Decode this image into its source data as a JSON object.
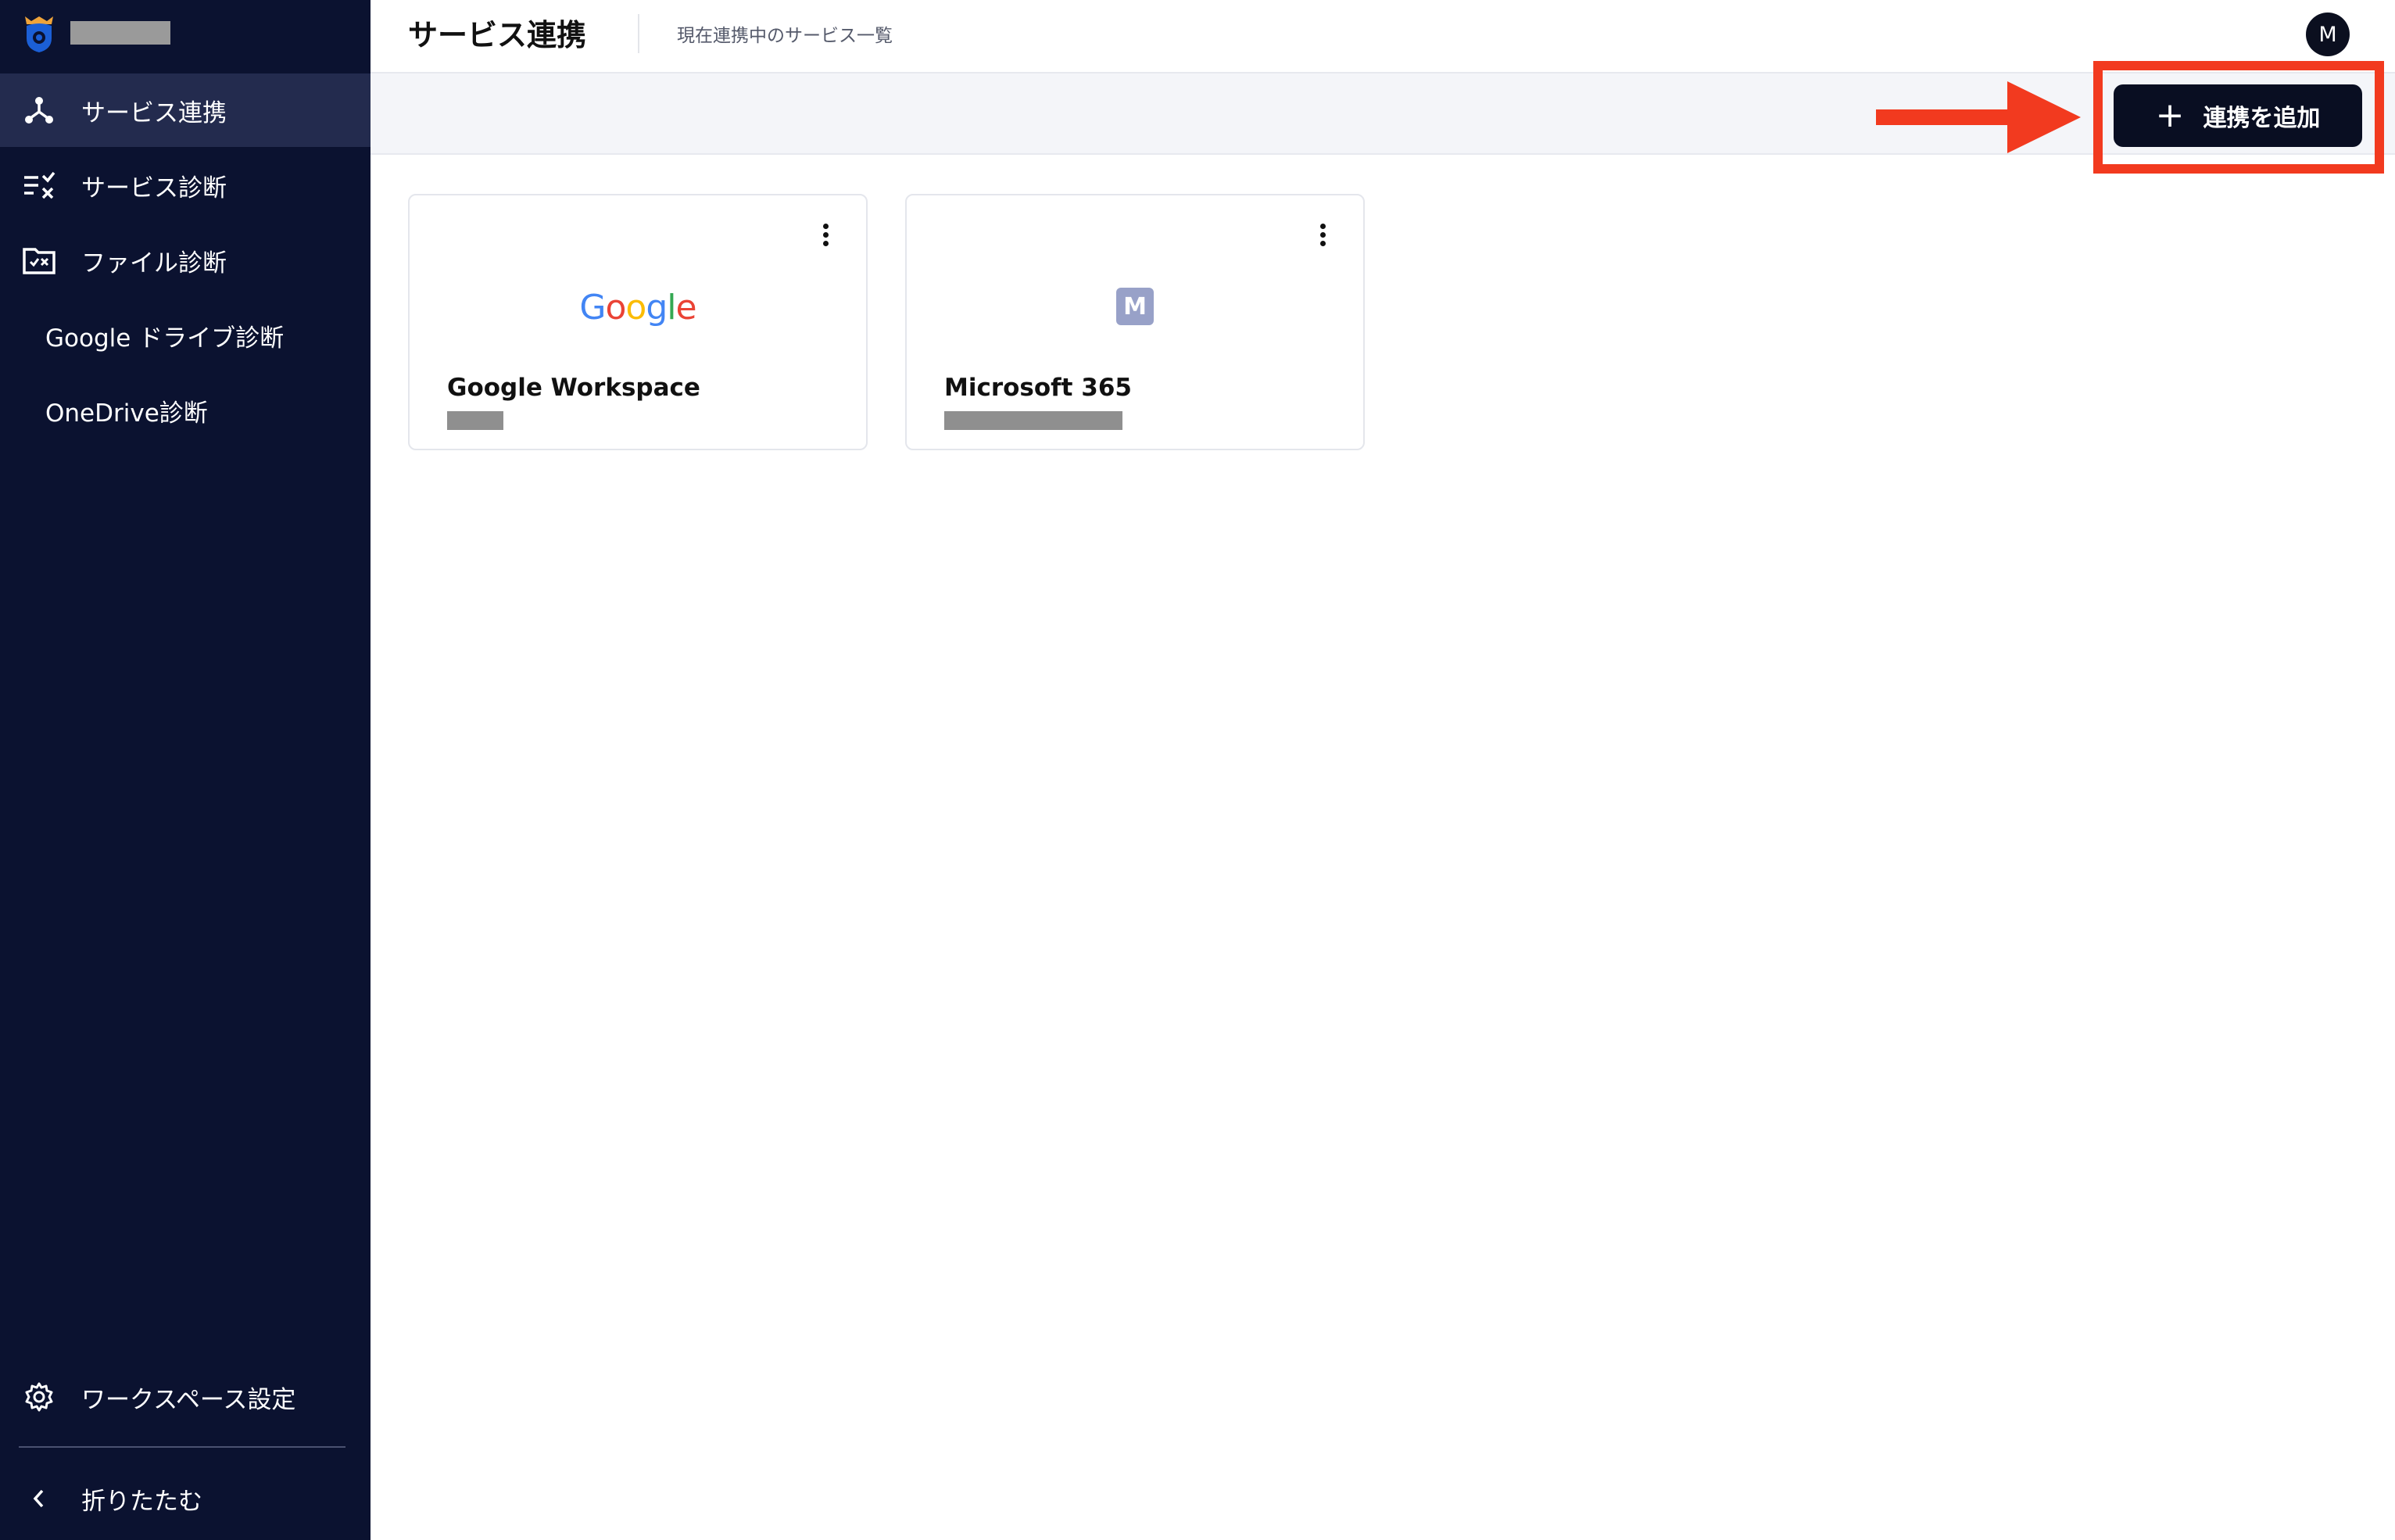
{
  "header": {
    "title": "サービス連携",
    "subtitle": "現在連携中のサービス一覧",
    "avatar_initial": "M"
  },
  "sidebar": {
    "items": [
      {
        "label": "サービス連携",
        "icon": "connection-icon",
        "active": true
      },
      {
        "label": "サービス診断",
        "icon": "checklist-icon",
        "active": false
      },
      {
        "label": "ファイル診断",
        "icon": "folder-scan-icon",
        "active": false
      },
      {
        "label": "Google ドライブ診断",
        "icon": "",
        "active": false
      },
      {
        "label": "OneDrive診断",
        "icon": "",
        "active": false
      }
    ],
    "footer": [
      {
        "label": "ワークスペース設定",
        "icon": "gear-icon"
      },
      {
        "label": "折りたたむ",
        "icon": "chevron-left-icon"
      }
    ]
  },
  "toolbar": {
    "add_button_label": "連携を追加",
    "add_button_icon": "plus-icon"
  },
  "cards": [
    {
      "name": "Google Workspace",
      "logo_text": "Google",
      "logo": "google-logo"
    },
    {
      "name": "Microsoft 365",
      "logo_text": "M",
      "logo": "microsoft-365-tile"
    }
  ],
  "colors": {
    "sidebar_bg": "#0b1230",
    "sidebar_active": "#232b4e",
    "primary_button": "#090e22",
    "annotation_red": "#f23a1f",
    "toolbar_bg": "#f4f5f9",
    "ms_tile": "#98a1c8"
  }
}
